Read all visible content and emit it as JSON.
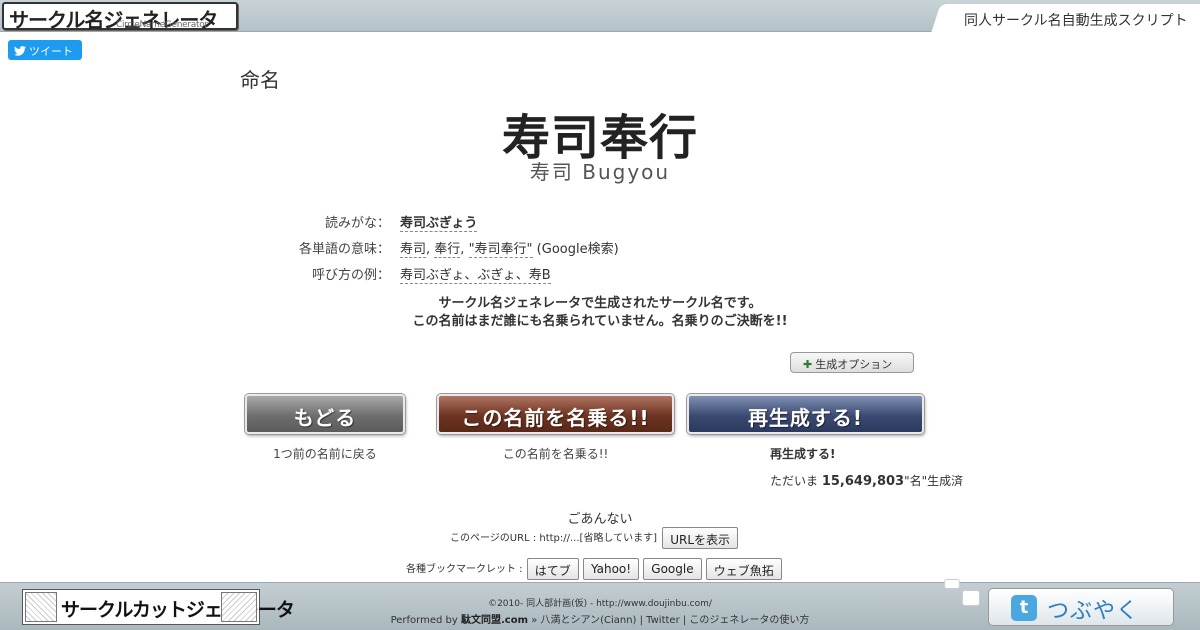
{
  "header": {
    "logo_main": "サークル名ジェネレータ",
    "logo_sub": "CircleNameGenerator",
    "site_title": "同人サークル名自動生成スクリプト",
    "tweet_label": "ツイート"
  },
  "result": {
    "heading": "命名",
    "name": "寿司奉行",
    "reading_sub": "寿司 Bugyou"
  },
  "info": {
    "reading_label": "読みがな：",
    "reading_value": "寿司ぶぎょう",
    "meaning_label": "各単語の意味：",
    "meaning_links": [
      "寿司",
      "奉行",
      "\"寿司奉行\""
    ],
    "meaning_suffix": "(Google検索)",
    "callname_label": "呼び方の例：",
    "callname_value": "寿司ぶぎょ、ぶぎょ、寿B"
  },
  "message": {
    "line1": "サークル名ジェネレータで生成されたサークル名です。",
    "line2": "この名前はまだ誰にも名乗られていません。名乗りのご決断を!!"
  },
  "options_button": "生成オプション",
  "buttons": {
    "back": "もどる",
    "take": "この名前を名乗る!!",
    "regen": "再生成する!"
  },
  "captions": {
    "back": "1つ前の名前に戻る",
    "take": "この名前を名乗る!!",
    "regen": "再生成する!",
    "count_prefix": "ただいま",
    "count_value": "15,649,803",
    "count_suffix": "\"名\"生成済"
  },
  "share": {
    "sorry": "ごあんない",
    "url_label": "このページのURL : http://...[省略しています]",
    "url_button": "URLを表示",
    "bookmark_label": "各種ブックマークレット :",
    "bookmark_buttons": [
      "はてブ",
      "Yahoo!",
      "Google",
      "ウェブ魚拓"
    ]
  },
  "footer": {
    "cut_logo": "サークルカットジェネレータ",
    "copyright": "©2010- 同人部計画(仮) - http://www.doujinbu.com/",
    "performed_prefix": "Performed by",
    "performed_org": "駄文同盟.com",
    "performed_rest": "» 八満とシアン(Ciann) | Twitter | このジェネレータの使い方",
    "tsubuyaku": "つぶやく",
    "tsubuyaku_icon": "t"
  },
  "colors": {
    "back_button": "#6e6e6e",
    "take_button": "#6e3422",
    "regen_button": "#3b4a72",
    "twitter": "#1d9bf0"
  }
}
